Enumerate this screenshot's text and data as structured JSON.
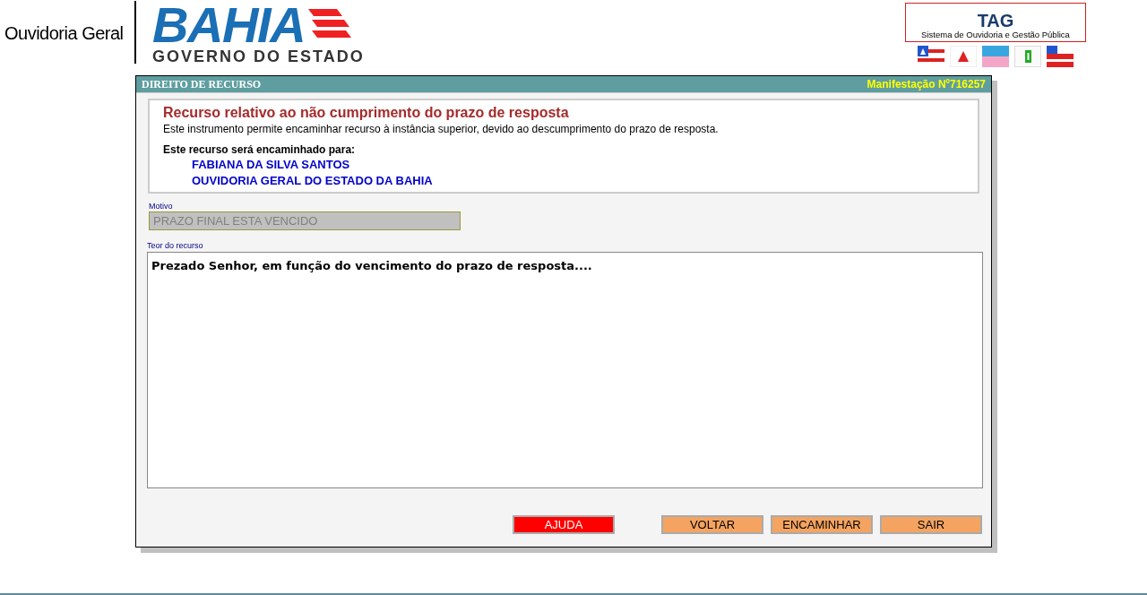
{
  "header": {
    "title": "Ouvidoria Geral",
    "logo_main": "BAHIA",
    "logo_sub": "GOVERNO DO ESTADO",
    "tag_logo": "TAG",
    "tag_caption": "Sistema de Ouvidoria e Gestão Pública"
  },
  "panel": {
    "title": "DIREITO DE RECURSO",
    "number": "Manifestação Nº716257"
  },
  "info": {
    "heading": "Recurso relativo ao não cumprimento do prazo de resposta",
    "description": "Este instrumento permite encaminhar recurso à instância superior, devido ao descumprimento do prazo de resposta.",
    "recipients_label": "Este recurso será encaminhado para:",
    "recipients": [
      "FABIANA DA SILVA SANTOS",
      "OUVIDORIA GERAL DO ESTADO DA BAHIA"
    ]
  },
  "motivo": {
    "label": "Motivo",
    "value": "PRAZO FINAL ESTA VENCIDO",
    "disabled": true
  },
  "teor": {
    "label": "Teor do recurso",
    "value": "Prezado Senhor, em função do vencimento do prazo de resposta...."
  },
  "buttons": [
    {
      "label": "AJUDA",
      "kind": "help"
    },
    {
      "label": "VOLTAR",
      "kind": "action"
    },
    {
      "label": "ENCAMINHAR",
      "kind": "action"
    },
    {
      "label": "SAIR",
      "kind": "action"
    }
  ]
}
